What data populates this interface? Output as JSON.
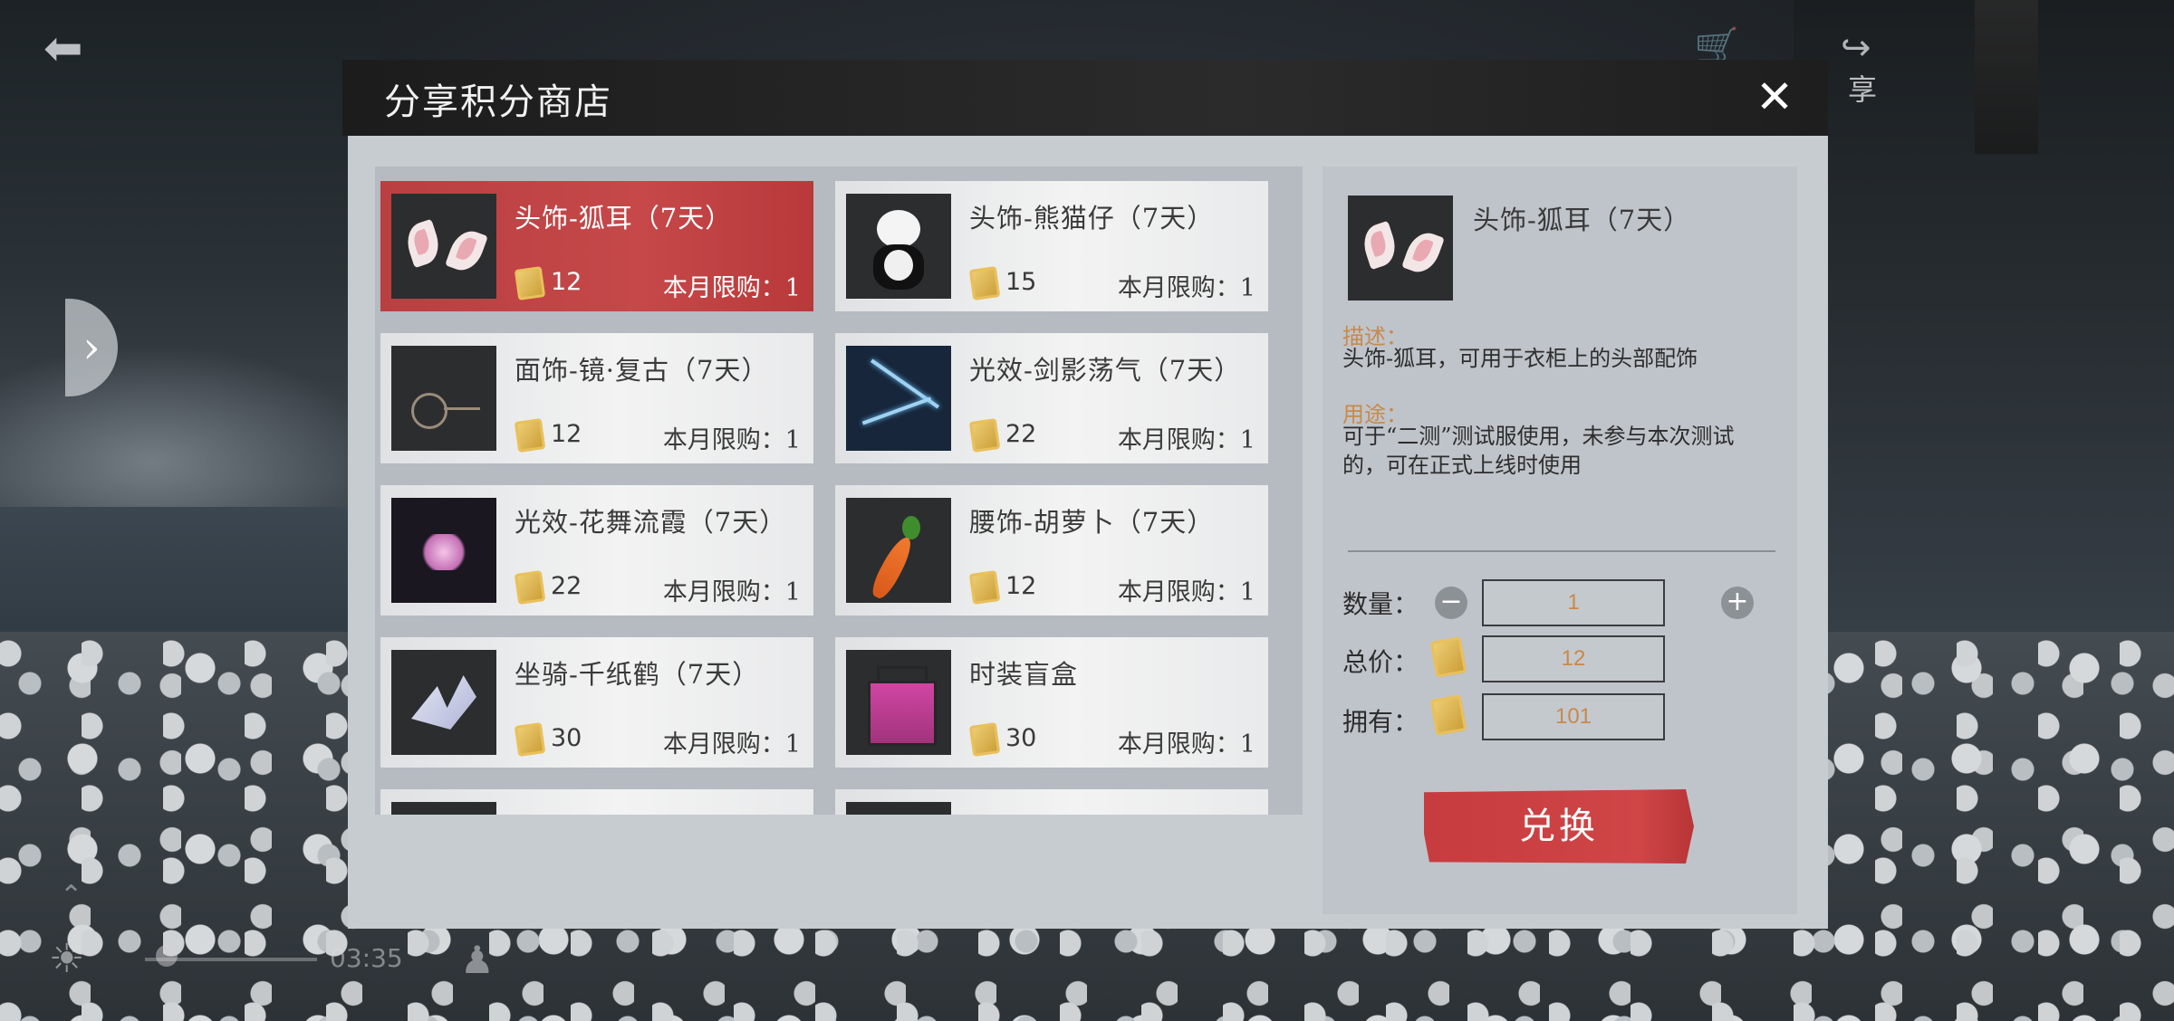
{
  "hud": {
    "share_label": "享",
    "time": "03:35"
  },
  "shop": {
    "title": "分享积分商店",
    "items": [
      {
        "name": "头饰-狐耳（7天）",
        "price": "12",
        "limit": "本月限购：1"
      },
      {
        "name": "头饰-熊猫仔（7天）",
        "price": "15",
        "limit": "本月限购：1"
      },
      {
        "name": "面饰-镜·复古（7天）",
        "price": "12",
        "limit": "本月限购：1"
      },
      {
        "name": "光效-剑影荡气（7天）",
        "price": "22",
        "limit": "本月限购：1"
      },
      {
        "name": "光效-花舞流霞（7天）",
        "price": "22",
        "limit": "本月限购：1"
      },
      {
        "name": "腰饰-胡萝卜（7天）",
        "price": "12",
        "limit": "本月限购：1"
      },
      {
        "name": "坐骑-千纸鹤（7天）",
        "price": "30",
        "limit": "本月限购：1"
      },
      {
        "name": "时装盲盒",
        "price": "30",
        "limit": "本月限购：1"
      }
    ],
    "selected_index": 0
  },
  "detail": {
    "name": "头饰-狐耳（7天）",
    "desc_label": "描述：",
    "desc_text": "头饰-狐耳，可用于衣柜上的头部配饰",
    "use_label": "用途：",
    "use_text": "可于“二测”测试服使用，未参与本次测试的，可在正式上线时使用",
    "quantity_label": "数量：",
    "quantity": "1",
    "total_label": "总价：",
    "total": "12",
    "owned_label": "拥有：",
    "owned": "101",
    "exchange_label": "兑换"
  },
  "colors": {
    "accent_red": "#c64849",
    "value_orange": "#c9894a"
  }
}
